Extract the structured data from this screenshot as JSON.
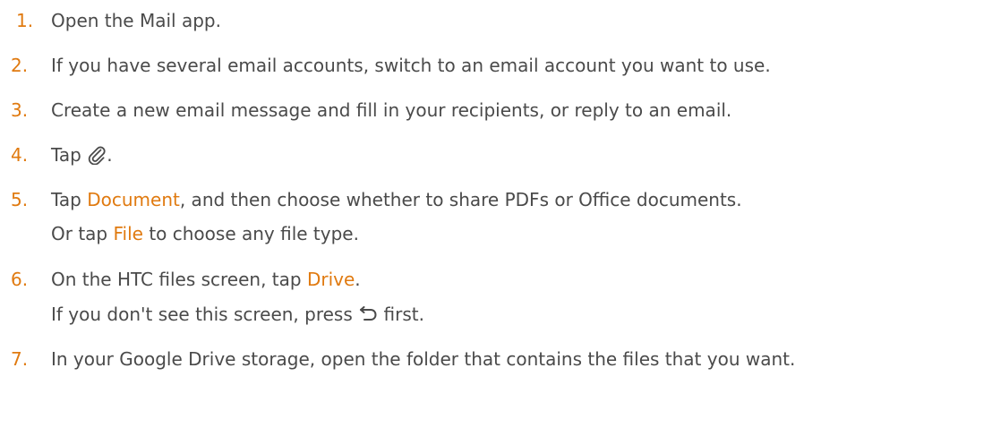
{
  "steps": [
    {
      "num": "1.",
      "text": "Open the Mail app."
    },
    {
      "num": "2.",
      "text": "If you have several email accounts, switch to an email account you want to use."
    },
    {
      "num": "3.",
      "text": "Create a new email message and fill in your recipients, or reply to an email."
    },
    {
      "num": "4.",
      "pre": "Tap",
      "icon": "paperclip-icon",
      "post": "."
    },
    {
      "num": "5.",
      "pre": "Tap",
      "bold": "Document",
      "post": ", and then choose whether to share PDFs or Office documents.",
      "sub": {
        "pre": "Or tap",
        "bold": "File",
        "post": "to choose any file type."
      }
    },
    {
      "num": "6.",
      "pre": "On the HTC files screen, tap",
      "bold": "Drive",
      "post": ".",
      "sub": {
        "pre": "If you don't see this screen, press",
        "icon": "back-arrow-icon",
        "post": "first."
      }
    },
    {
      "num": "7.",
      "text": "In your Google Drive storage, open the folder that contains the files that you want."
    }
  ],
  "colors": {
    "accent": "#e07a10",
    "text": "#4a4a4a"
  }
}
